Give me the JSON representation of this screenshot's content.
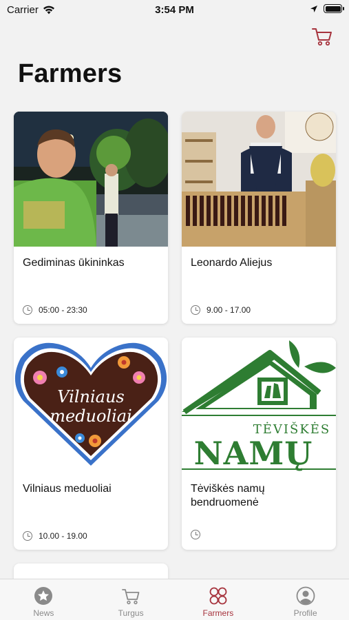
{
  "status": {
    "carrier": "Carrier",
    "time": "3:54 PM"
  },
  "page": {
    "title": "Farmers"
  },
  "farmers": [
    {
      "name": "Gediminas ūkininkas",
      "hours": "05:00 - 23:30"
    },
    {
      "name": "Leonardo Aliejus",
      "hours": "9.00 - 17.00"
    },
    {
      "name": "Vilniaus meduoliai",
      "hours": "10.00 - 19.00",
      "logo_text": [
        "Vilniaus",
        "meduoliai"
      ]
    },
    {
      "name": "Tėviškės namų bendruomenė",
      "hours": "",
      "logo_text": [
        "TĖVIŠKĖS",
        "NAMŲ"
      ]
    }
  ],
  "tabs": [
    {
      "label": "News",
      "icon": "star-icon"
    },
    {
      "label": "Turgus",
      "icon": "cart-icon"
    },
    {
      "label": "Farmers",
      "icon": "grid-circles-icon",
      "active": true
    },
    {
      "label": "Profile",
      "icon": "profile-icon"
    }
  ],
  "colors": {
    "accent": "#a6333d",
    "inactive": "#8a8a8a",
    "background": "#f2f2f2",
    "logo_green": "#2e7d32"
  }
}
